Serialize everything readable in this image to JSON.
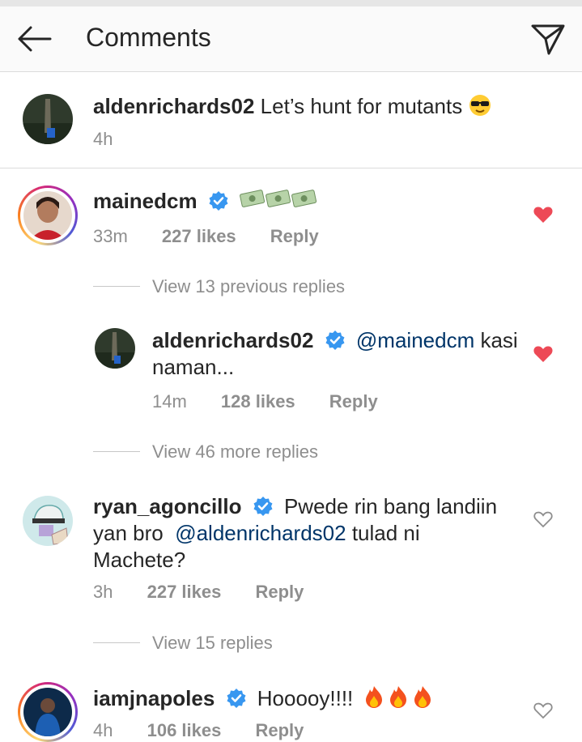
{
  "header": {
    "title": "Comments"
  },
  "caption": {
    "username": "aldenrichards02",
    "text": "Let’s hunt for mutants",
    "time": "4h"
  },
  "comments": [
    {
      "username": "mainedcm",
      "text": "",
      "time": "33m",
      "likes": "227 likes",
      "reply": "Reply",
      "liked": true,
      "view_replies": "View 13 previous replies"
    },
    {
      "username": "aldenrichards02",
      "mention": "@mainedcm",
      "text_after": "kasi",
      "text_line2": "naman...",
      "time": "14m",
      "likes": "128 likes",
      "reply": "Reply",
      "liked": true,
      "view_replies": "View 46 more replies"
    },
    {
      "username": "ryan_agoncillo",
      "text_line1": "Pwede rin bang landiin",
      "text_line2_pre": "yan bro",
      "mention": "@aldenrichards02",
      "text_line2_post": "tulad ni",
      "text_line3": "Machete?",
      "time": "3h",
      "likes": "227 likes",
      "reply": "Reply",
      "liked": false,
      "view_replies": "View 15 replies"
    },
    {
      "username": "iamjnapoles",
      "text": "Hooooy!!!!",
      "time": "4h",
      "likes": "106 likes",
      "reply": "Reply",
      "liked": false
    }
  ],
  "colors": {
    "heart_liked": "#ed4956",
    "verified": "#3897f0",
    "mention": "#003569",
    "muted": "#8e8e8e"
  }
}
